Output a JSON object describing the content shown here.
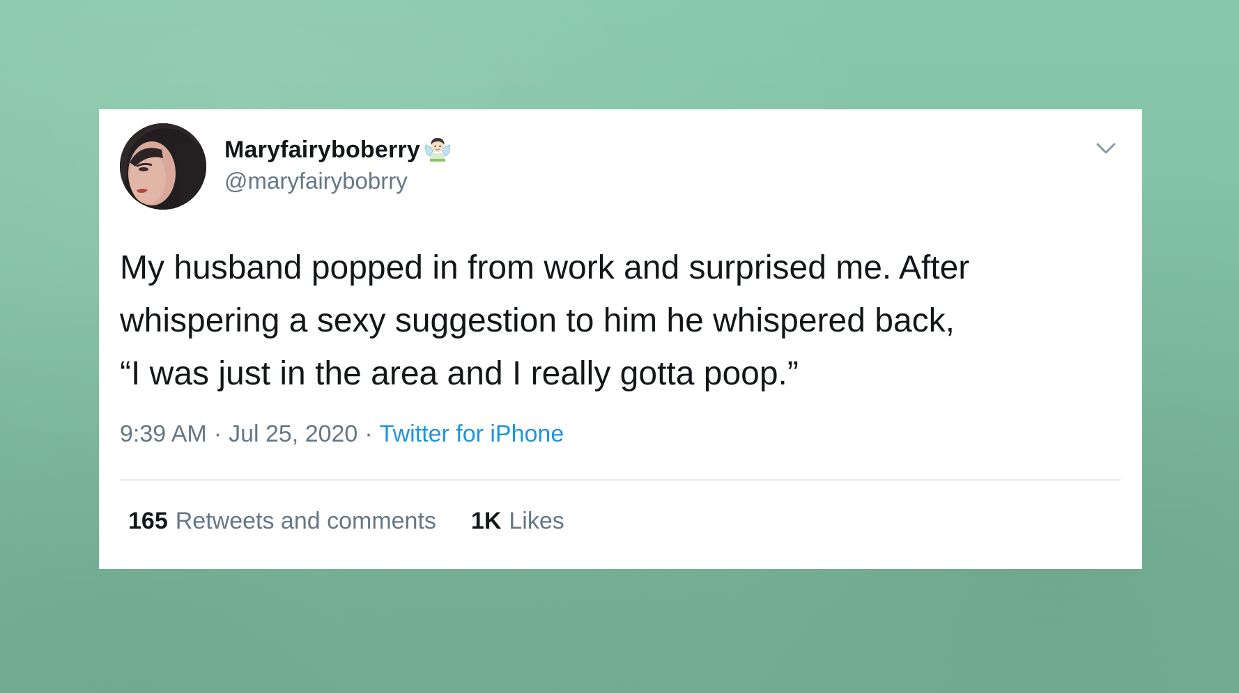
{
  "tweet": {
    "display_name": "Maryfairyboberry",
    "name_emoji": "fairy-emoji",
    "handle": "@maryfairybobrry",
    "text_lines": [
      "My husband popped in from work and surprised me. After",
      "whispering a sexy suggestion to him he whispered back,",
      "“I was just in the area and I really gotta poop.”"
    ],
    "time": "9:39 AM",
    "date": "Jul 25, 2020",
    "separator": "·",
    "source": "Twitter for iPhone",
    "retweets_count": "165",
    "retweets_label": "Retweets and comments",
    "likes_count": "1K",
    "likes_label": "Likes"
  },
  "icons": {
    "menu": "chevron-down-icon",
    "avatar": "profile-photo"
  },
  "colors": {
    "background": "#86c4a7",
    "card": "#ffffff",
    "text_primary": "#14171a",
    "text_secondary": "#657786",
    "link": "#1b95e0",
    "divider": "#e6ecf0"
  }
}
